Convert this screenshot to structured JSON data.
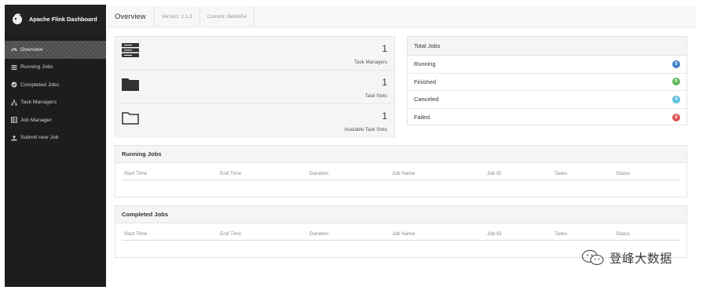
{
  "app": {
    "title": "Apache Flink Dashboard"
  },
  "sidebar": {
    "items": [
      {
        "label": "Overview",
        "icon": "dashboard-icon"
      },
      {
        "label": "Running Jobs",
        "icon": "list-icon"
      },
      {
        "label": "Completed Jobs",
        "icon": "check-circle-icon"
      },
      {
        "label": "Task Managers",
        "icon": "sitemap-icon"
      },
      {
        "label": "Job Manager",
        "icon": "grid-icon"
      },
      {
        "label": "Submit new Job",
        "icon": "upload-icon"
      }
    ]
  },
  "header": {
    "title": "Overview",
    "version": "Version: 1.1.3",
    "commit": "Commit: 8e8d454"
  },
  "stats": [
    {
      "value": "1",
      "label": "Task Managers",
      "icon": "server-icon"
    },
    {
      "value": "1",
      "label": "Task Slots",
      "icon": "folder-icon"
    },
    {
      "value": "1",
      "label": "Available Task Slots",
      "icon": "folder-open-icon"
    }
  ],
  "total_jobs": {
    "title": "Total Jobs",
    "rows": [
      {
        "label": "Running",
        "count": "0",
        "color": "#3f7fc1"
      },
      {
        "label": "Finished",
        "count": "0",
        "color": "#5cb85c"
      },
      {
        "label": "Canceled",
        "count": "0",
        "color": "#5bc0de"
      },
      {
        "label": "Failed",
        "count": "0",
        "color": "#d9534f"
      }
    ]
  },
  "running_jobs": {
    "title": "Running Jobs",
    "columns": [
      "Start Time",
      "End Time",
      "Duration",
      "Job Name",
      "Job ID",
      "Tasks",
      "Status"
    ]
  },
  "completed_jobs": {
    "title": "Completed Jobs",
    "columns": [
      "Start Time",
      "End Time",
      "Duration",
      "Job Name",
      "Job ID",
      "Tasks",
      "Status"
    ]
  },
  "watermark": {
    "text": "登峰大数据"
  }
}
